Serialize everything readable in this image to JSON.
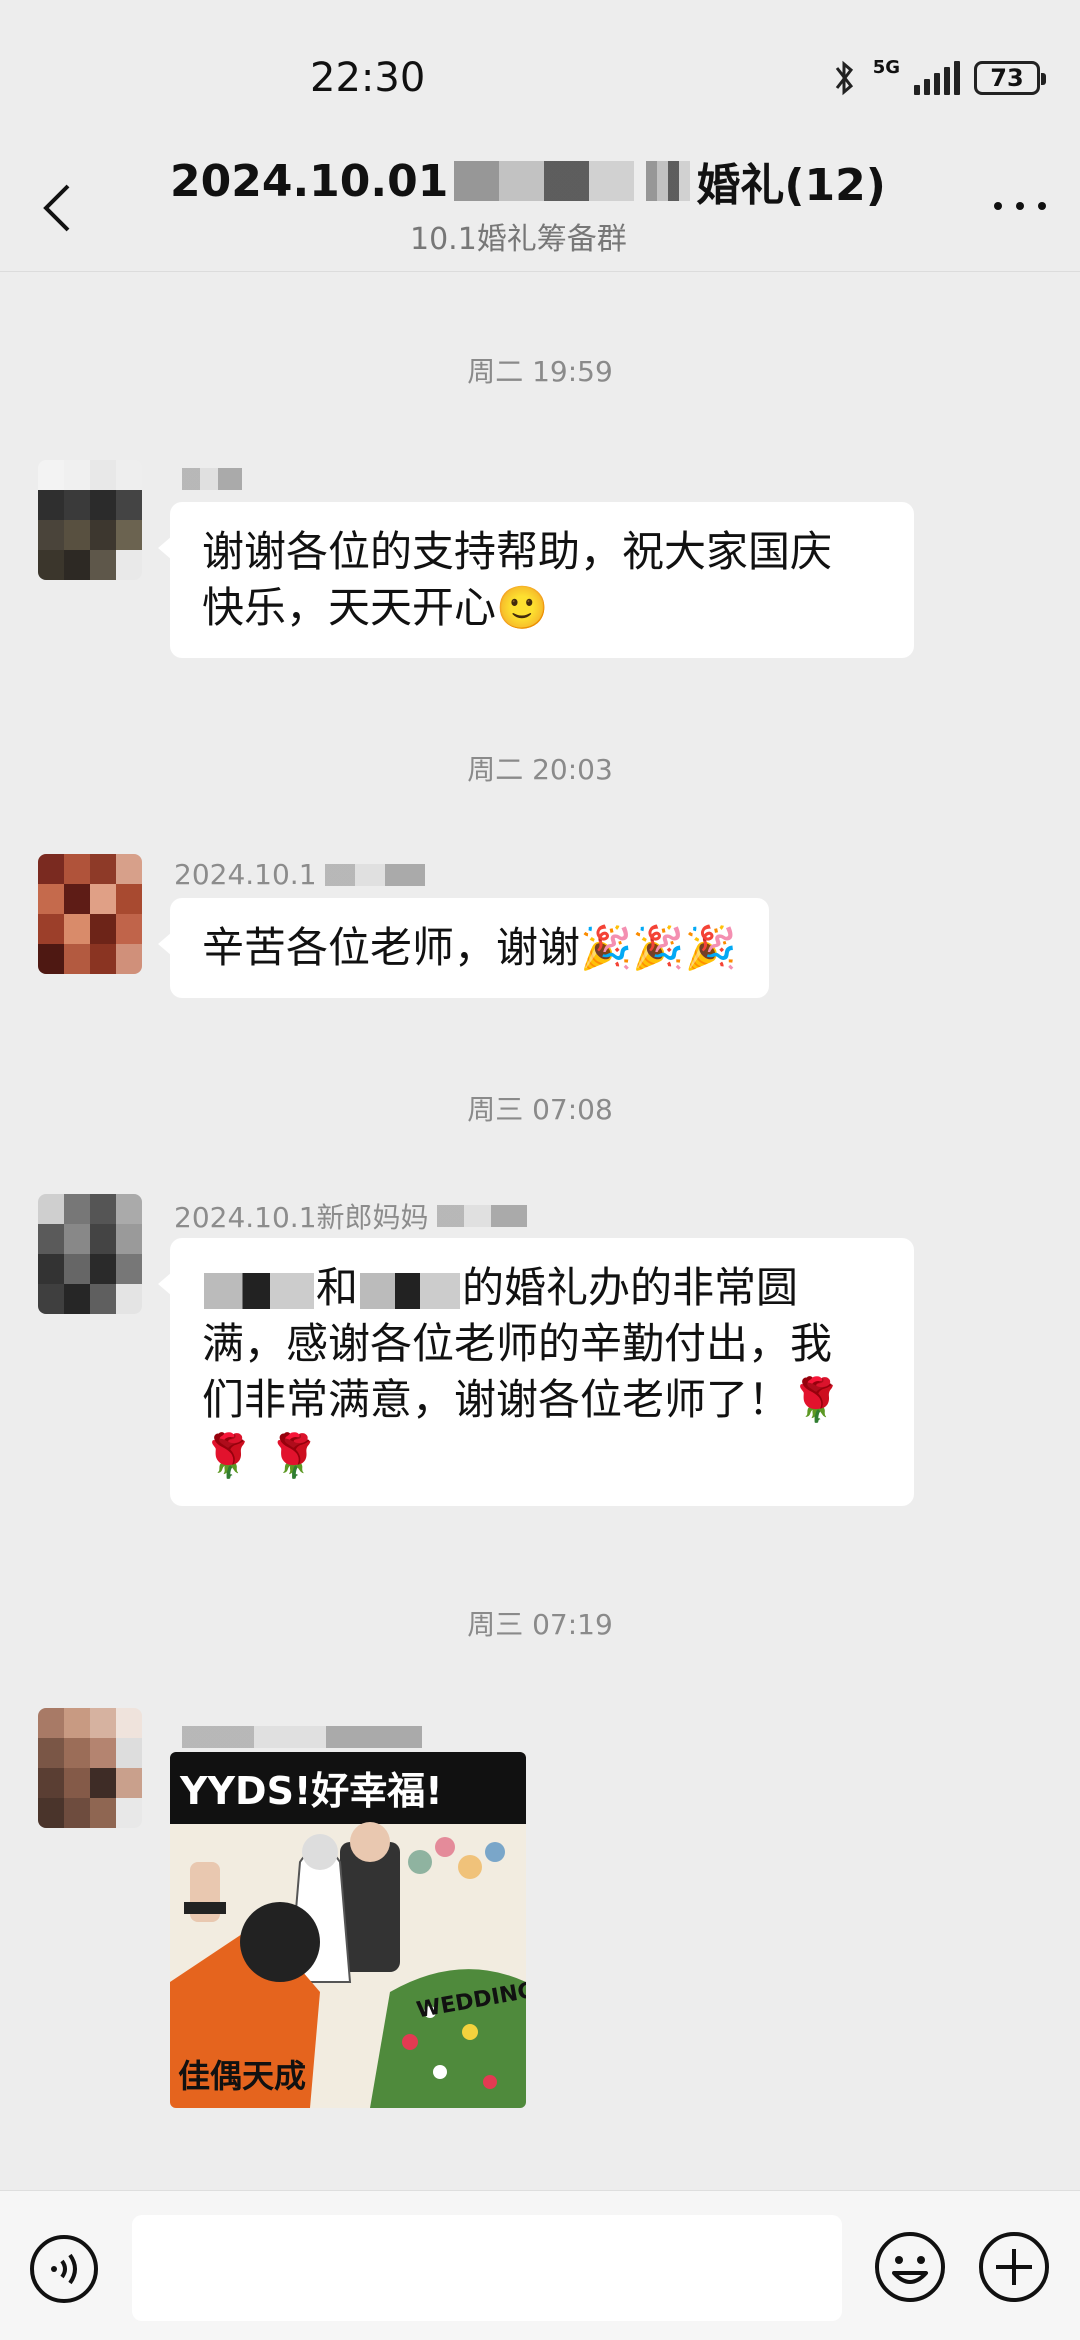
{
  "status_bar": {
    "time": "22:30",
    "network": "5G",
    "battery": "73",
    "icons": [
      "bluetooth-icon",
      "signal-icon",
      "battery-icon"
    ]
  },
  "header": {
    "title_prefix": "2024.10.01",
    "title_suffix": "婚礼(12)",
    "subtitle": "10.1婚礼筹备群",
    "back_icon": "chevron-left-icon",
    "more_icon": "more-dots-icon"
  },
  "messages": [
    {
      "timestamp": "周二 19:59",
      "sender": "",
      "text_line1": "谢谢各位的支持帮助，祝大家国庆",
      "text_line2": "快乐，天天开心🙂"
    },
    {
      "timestamp": "周二 20:03",
      "sender": "2024.10.1",
      "text": "辛苦各位老师，谢谢🎉🎉🎉"
    },
    {
      "timestamp": "周三 07:08",
      "sender": "2024.10.1新郎妈妈",
      "text_line1_a": "和",
      "text_line1_b": "的婚礼办的非常圆",
      "text_line2": "满，感谢各位老师的辛勤付出，我",
      "text_line3": "们非常满意，谢谢各位老师了！🌹",
      "text_line4": "🌹 🌹"
    },
    {
      "timestamp": "周三 07:19",
      "sender": "",
      "image_text_top": "YYDS!好幸福!",
      "image_text_bottom": "佳偶天成",
      "image_text_side": "WEDDING"
    }
  ],
  "input_bar": {
    "voice_icon": "voice-icon",
    "emoji_icon": "smiley-icon",
    "plus_icon": "plus-icon",
    "placeholder": ""
  },
  "colors": {
    "background": "#ededed",
    "bubble": "#ffffff",
    "timestamp": "#8a8a8a"
  }
}
